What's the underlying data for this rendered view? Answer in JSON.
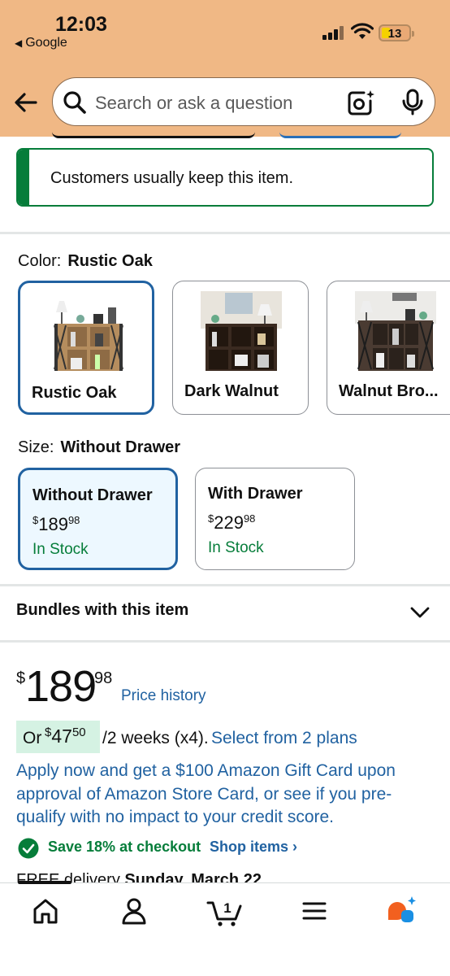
{
  "status_bar": {
    "time": "12:03",
    "back_app": "Google",
    "battery": "13"
  },
  "search": {
    "placeholder": "Search or ask a question"
  },
  "banner": {
    "text": "Customers usually keep this item."
  },
  "color": {
    "label": "Color:",
    "selected": "Rustic Oak",
    "options": [
      {
        "name": "Rustic Oak",
        "selected": true,
        "finish": "#b58d5e"
      },
      {
        "name": "Dark Walnut",
        "selected": false,
        "finish": "#3a2a20"
      },
      {
        "name": "Walnut Bro...",
        "selected": false,
        "finish": "#4a3b32"
      }
    ]
  },
  "size": {
    "label": "Size:",
    "selected": "Without Drawer",
    "options": [
      {
        "name": "Without Drawer",
        "price_whole": "189",
        "price_frac": "98",
        "currency": "$",
        "stock": "In Stock",
        "selected": true
      },
      {
        "name": "With Drawer",
        "price_whole": "229",
        "price_frac": "98",
        "currency": "$",
        "stock": "In Stock",
        "selected": false
      }
    ]
  },
  "bundles": {
    "label": "Bundles with this item"
  },
  "price": {
    "currency": "$",
    "whole": "189",
    "fraction": "98",
    "history_link": "Price history"
  },
  "installment": {
    "prefix": "Or",
    "currency": "$",
    "amount_whole": "47",
    "amount_frac": "50",
    "period": "/2 weeks (x4).",
    "link": "Select from 2 plans"
  },
  "card_offer": "Apply now and get a $100 Amazon Gift Card upon approval of Amazon Store Card, or see if you pre-qualify with no impact to your credit score.",
  "savings": {
    "text": "Save 18% at checkout",
    "link": "Shop items",
    "link_arrow": "›"
  },
  "delivery": {
    "prefix": "FREE delivery",
    "date": "Sunday, March 22"
  },
  "bottom_nav": {
    "cart_count": "1",
    "items": [
      "home-icon",
      "account-icon",
      "cart-icon",
      "menu-icon",
      "rufus-icon"
    ]
  },
  "colors": {
    "header_bg": "#f0b885",
    "link_blue": "#2162a1",
    "selected_border": "#2162a1",
    "stock_green": "#067d3a",
    "installment_highlight": "#d5f2e3"
  }
}
